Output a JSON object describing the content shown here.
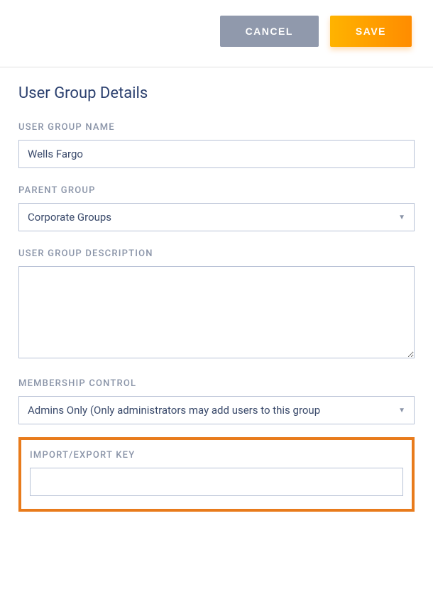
{
  "buttons": {
    "cancel": "CANCEL",
    "save": "SAVE"
  },
  "form": {
    "title": "User Group Details",
    "fields": {
      "group_name": {
        "label": "USER GROUP NAME",
        "value": "Wells Fargo"
      },
      "parent_group": {
        "label": "PARENT GROUP",
        "value": "Corporate Groups"
      },
      "description": {
        "label": "USER GROUP DESCRIPTION",
        "value": ""
      },
      "membership_control": {
        "label": "MEMBERSHIP CONTROL",
        "value": "Admins Only (Only administrators may add users to this group"
      },
      "import_export_key": {
        "label": "IMPORT/EXPORT KEY",
        "value": ""
      }
    }
  }
}
